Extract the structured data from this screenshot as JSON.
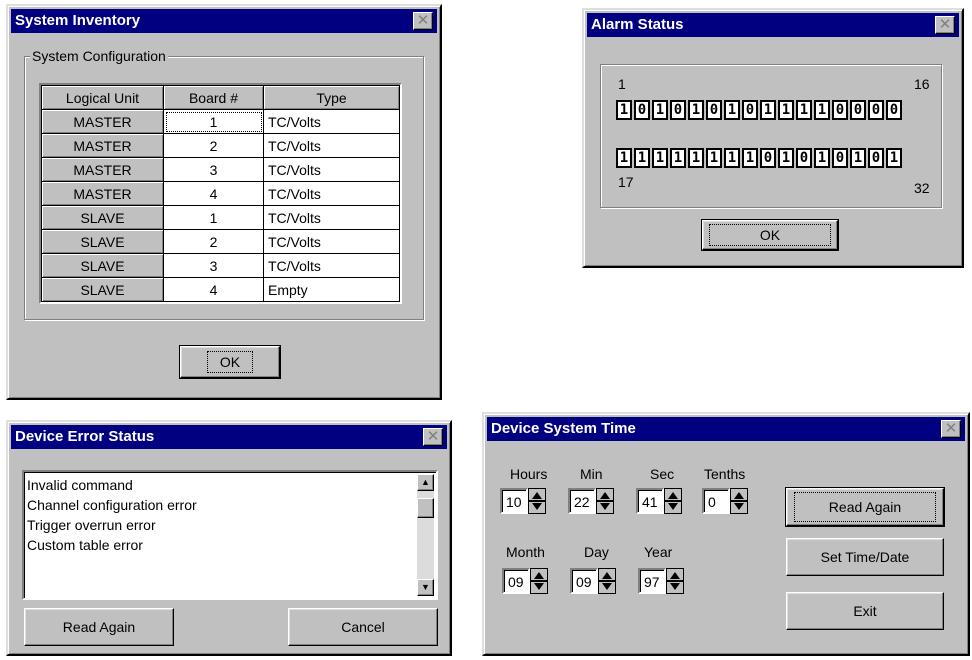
{
  "inventory": {
    "title": "System Inventory",
    "group_label": "System Configuration",
    "columns": [
      "Logical Unit",
      "Board #",
      "Type"
    ],
    "rows": [
      [
        "MASTER",
        "1",
        "TC/Volts"
      ],
      [
        "MASTER",
        "2",
        "TC/Volts"
      ],
      [
        "MASTER",
        "3",
        "TC/Volts"
      ],
      [
        "MASTER",
        "4",
        "TC/Volts"
      ],
      [
        "SLAVE",
        "1",
        "TC/Volts"
      ],
      [
        "SLAVE",
        "2",
        "TC/Volts"
      ],
      [
        "SLAVE",
        "3",
        "TC/Volts"
      ],
      [
        "SLAVE",
        "4",
        "Empty"
      ]
    ],
    "ok_label": "OK",
    "close_glyph": "✕"
  },
  "alarm": {
    "title": "Alarm Status",
    "label_1": "1",
    "label_16": "16",
    "label_17": "17",
    "label_32": "32",
    "bits_row1": [
      "1",
      "0",
      "1",
      "0",
      "1",
      "0",
      "1",
      "0",
      "1",
      "1",
      "1",
      "1",
      "0",
      "0",
      "0",
      "0"
    ],
    "bits_row2": [
      "1",
      "1",
      "1",
      "1",
      "1",
      "1",
      "1",
      "1",
      "0",
      "1",
      "0",
      "1",
      "0",
      "1",
      "0",
      "1"
    ],
    "ok_label": "OK",
    "close_glyph": "✕"
  },
  "errors": {
    "title": "Device Error Status",
    "items": [
      "Invalid  command",
      "Channel configuration error",
      "Trigger overrun error",
      "Custom table error"
    ],
    "read_again_label": "Read Again",
    "cancel_label": "Cancel",
    "close_glyph": "✕"
  },
  "time": {
    "title": "Device System Time",
    "hours_label": "Hours",
    "hours": "10",
    "min_label": "Min",
    "min": "22",
    "sec_label": "Sec",
    "sec": "41",
    "tenths_label": "Tenths",
    "tenths": "0",
    "month_label": "Month",
    "month": "09",
    "day_label": "Day",
    "day": "09",
    "year_label": "Year",
    "year": "97",
    "read_again_label": "Read Again",
    "set_label": "Set Time/Date",
    "exit_label": "Exit",
    "close_glyph": "✕"
  },
  "colors": {
    "titlebar": "#000080",
    "face": "#c0c0c0"
  }
}
